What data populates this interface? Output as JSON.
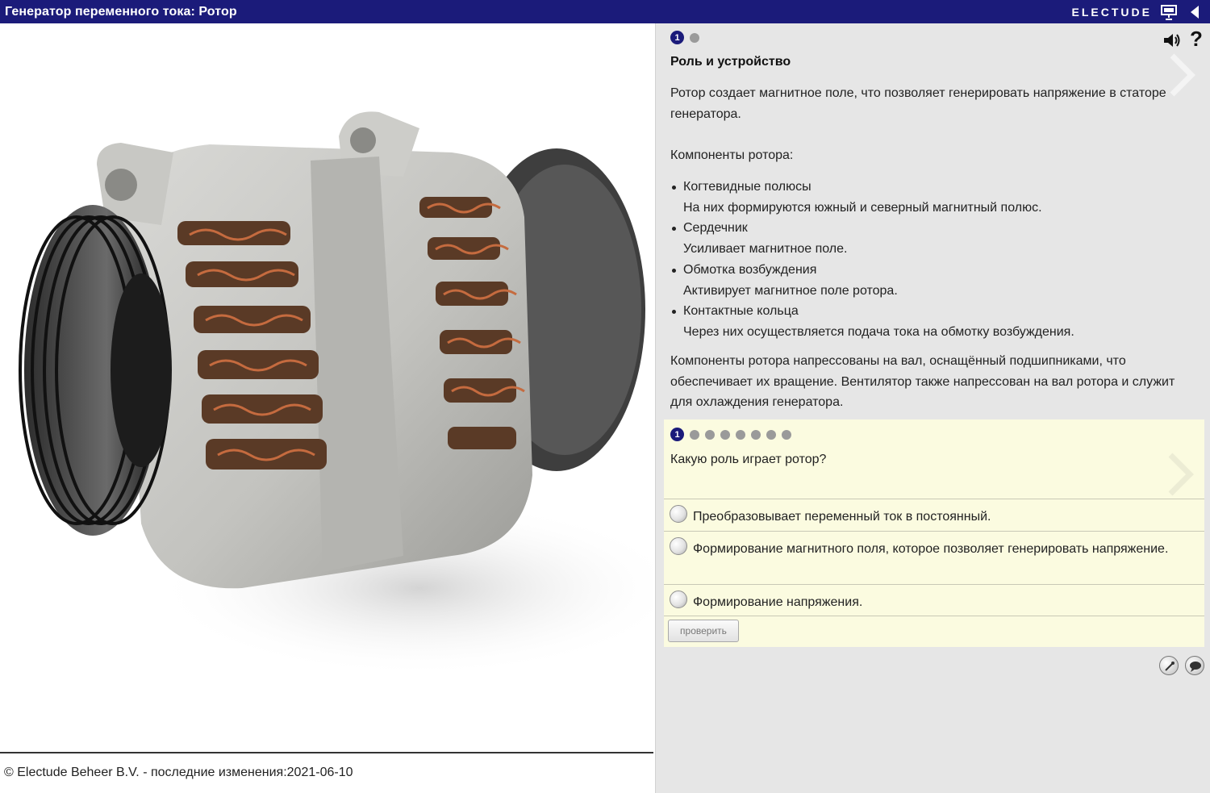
{
  "titlebar": {
    "title": "Генератор переменного тока: Ротор",
    "brand": "ELECTUDE",
    "icons": [
      "presentation-icon",
      "collapse-left-icon"
    ]
  },
  "left": {
    "image": "alternator-image",
    "copyright": "© Electude Beheer B.V. - последние изменения:2021-06-10"
  },
  "content": {
    "page_dots": {
      "current": "1",
      "total": 2
    },
    "section_title": "Роль и устройство",
    "intro": "Ротор создает магнитное поле, что позволяет генерировать напряжение в статоре генератора.",
    "components_heading": "Компоненты ротора:",
    "components": [
      {
        "name": "Когтевидные полюсы",
        "desc": "На них формируются южный и северный магнитный полюс."
      },
      {
        "name": "Сердечник",
        "desc": "Усиливает магнитное поле."
      },
      {
        "name": "Обмотка возбуждения",
        "desc": "Активирует магнитное поле ротора."
      },
      {
        "name": "Контактные кольца",
        "desc": "Через них осуществляется подача тока на обмотку возбуждения."
      }
    ],
    "closing": "Компоненты ротора напрессованы на вал, оснащённый подшипниками, что обеспечивает их вращение. Вентилятор также напрессован на вал ротора и служит для охлаждения генератора."
  },
  "quiz": {
    "dots": {
      "current": "1",
      "total": 8
    },
    "question": "Какую роль играет ротор?",
    "answers": [
      "Преобразовывает переменный ток в постоянный.",
      "Формирование магнитного поля, которое позволяет генерировать напряжение.",
      "Формирование напряжения."
    ],
    "check_label": "проверить"
  },
  "colors": {
    "titlebar": "#1b1b7a",
    "panel": "#e6e6e6",
    "quiz_bg": "#fbfbe0"
  }
}
